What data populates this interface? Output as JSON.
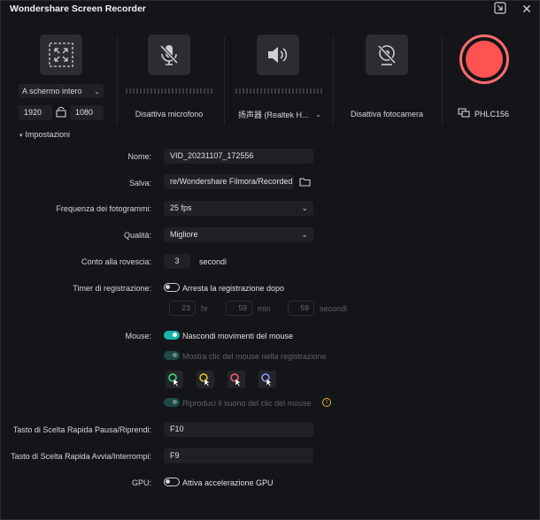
{
  "window": {
    "title": "Wondershare Screen Recorder"
  },
  "titlebar": {
    "icons": [
      "picture-in-picture-icon",
      "close-icon"
    ]
  },
  "area": {
    "mode": "A schermo intero",
    "width": "1920",
    "height": "1080"
  },
  "microphone": {
    "label": "Disattiva microfono"
  },
  "speaker": {
    "device": "扬声器 (Realtek H..."
  },
  "camera": {
    "label": "Disattiva fotocamera"
  },
  "display": {
    "label": "PHLC156"
  },
  "settings": {
    "header": "Impostazioni",
    "name_label": "Nome:",
    "name_value": "VID_20231107_172556",
    "save_label": "Salva:",
    "save_value": "re/Wondershare Filmora/Recorded",
    "fps_label": "Frequenza dei fotogrammi:",
    "fps_value": "25 fps",
    "quality_label": "Qualità:",
    "quality_value": "Migliore",
    "countdown_label": "Conto alla rovescia:",
    "countdown_value": "3",
    "countdown_unit": "secondi",
    "timer_label": "Timer di registrazione:",
    "timer_toggle": "Arresta la registrazione dopo",
    "timer_hours": "23",
    "timer_hours_unit": "hr",
    "timer_minutes": "59",
    "timer_minutes_unit": "min",
    "timer_seconds": "59",
    "timer_seconds_unit": "secondi",
    "mouse_label": "Mouse:",
    "mouse_hide": "Nascondi movimenti del mouse",
    "mouse_clicks": "Mostra clic del mouse nella registrazione",
    "mouse_sound": "Riproduci il suono del clic del mouse",
    "cursor_colors": [
      "#3ddc84",
      "#f5c518",
      "#ff5a6a",
      "#8c9bff"
    ],
    "hotkey_pause_label": "Tasto di Scelta Rapida Pausa/Riprendi:",
    "hotkey_pause_value": "F10",
    "hotkey_start_label": "Tasto di Scelta Rapida Avvia/Interrompi:",
    "hotkey_start_value": "F9",
    "gpu_label": "GPU:",
    "gpu_toggle": "Attiva accelerazione GPU"
  },
  "colors": {
    "accent": "#15b5a7",
    "record": "#ff5252",
    "warning": "#e3b51d"
  }
}
